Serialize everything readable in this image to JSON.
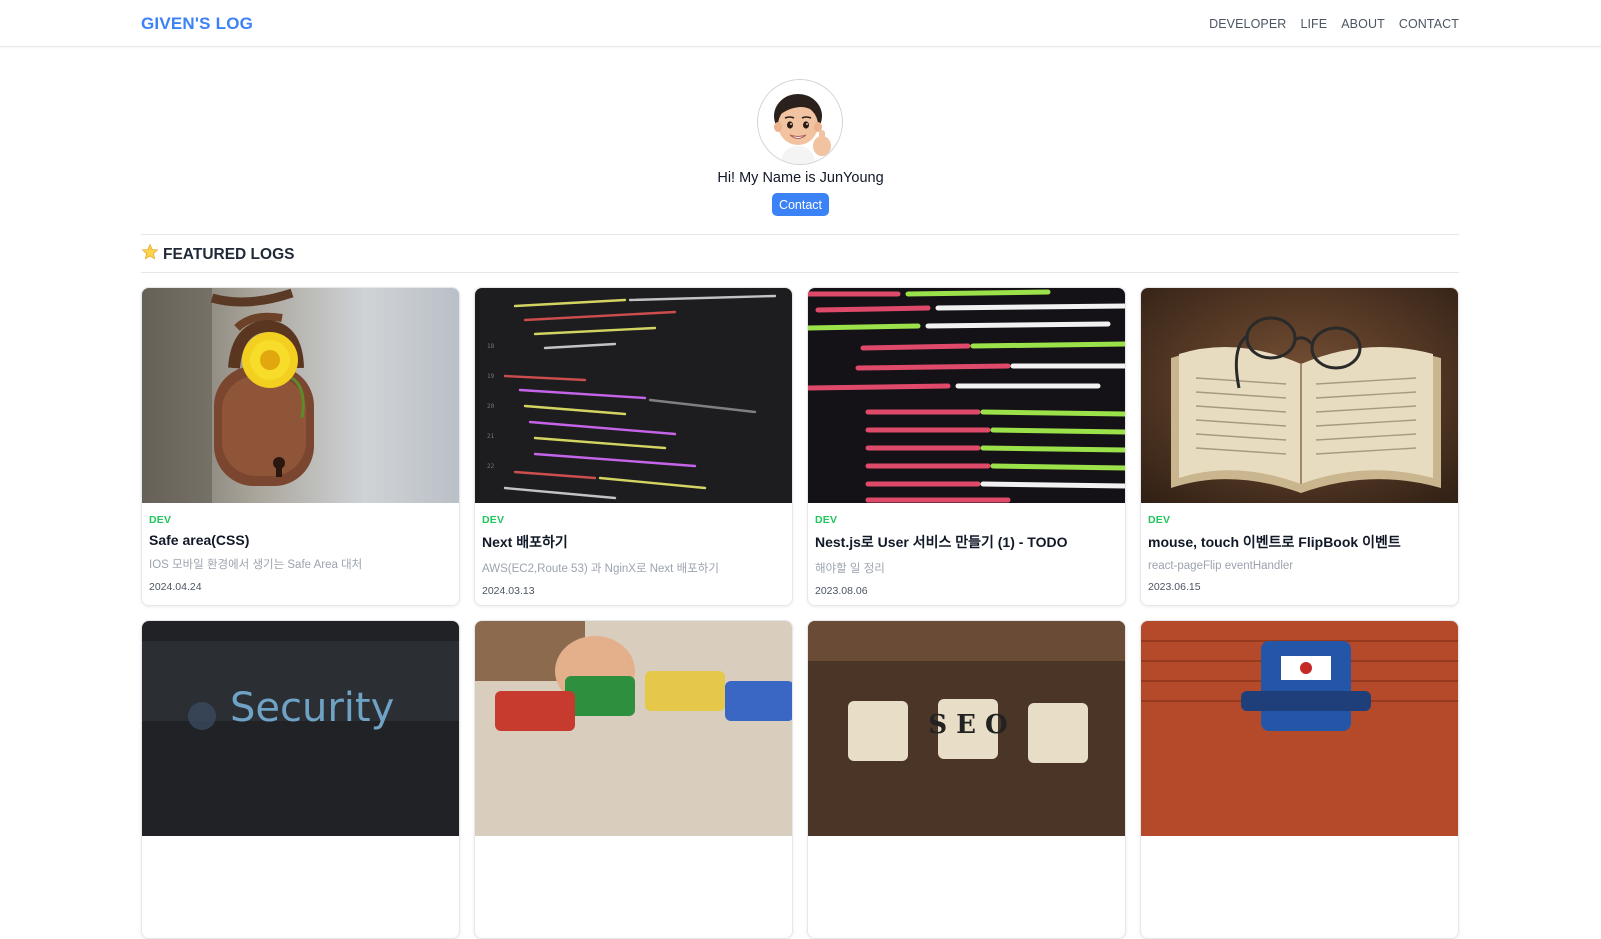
{
  "header": {
    "logo": "GIVEN'S LOG",
    "nav": [
      {
        "label": "DEVELOPER"
      },
      {
        "label": "LIFE"
      },
      {
        "label": "ABOUT"
      },
      {
        "label": "CONTACT"
      }
    ]
  },
  "profile": {
    "greeting": "Hi! My Name is JunYoung",
    "contact_label": "Contact"
  },
  "featured": {
    "icon": "star-icon",
    "title": "FEATURED LOGS"
  },
  "cards": [
    {
      "category": "DEV",
      "title": "Safe area(CSS)",
      "description": "IOS 모바일 환경에서 생기는 Safe Area 대처",
      "date": "2024.04.24",
      "image": "padlock-flower"
    },
    {
      "category": "DEV",
      "title": "Next 배포하기",
      "description": "AWS(EC2,Route 53) 과 NginX로 Next 배포하기",
      "date": "2024.03.13",
      "image": "code-screen"
    },
    {
      "category": "DEV",
      "title": "Nest.js로 User 서비스 만들기 (1) - TODO",
      "description": "해야할 일 정리",
      "date": "2023.08.06",
      "image": "html-code-screen"
    },
    {
      "category": "DEV",
      "title": "mouse, touch 이벤트로 FlipBook 이벤트",
      "description": "react-pageFlip eventHandler",
      "date": "2023.06.15",
      "image": "book-glasses"
    },
    {
      "image": "security-screen",
      "thumb_text": "Security"
    },
    {
      "image": "toy-blocks"
    },
    {
      "image": "seo-tiles",
      "thumb_text": "S E O"
    },
    {
      "image": "blue-mailbox"
    }
  ]
}
